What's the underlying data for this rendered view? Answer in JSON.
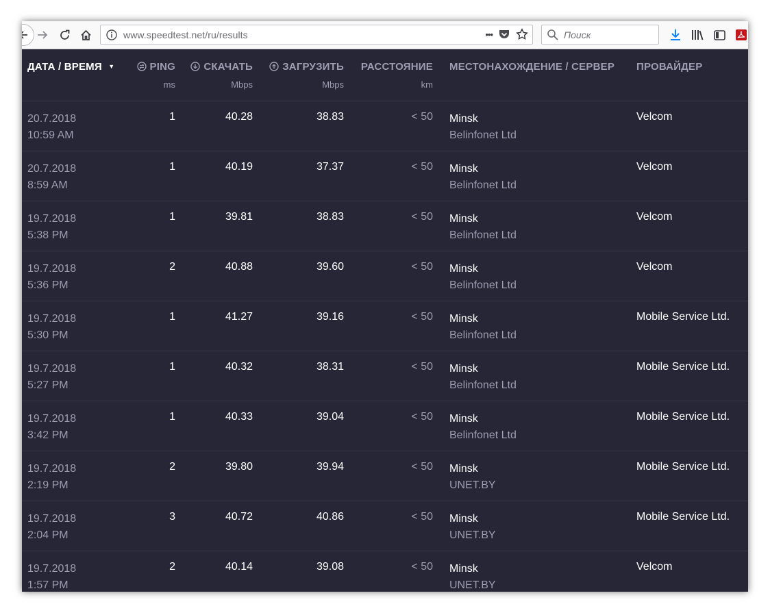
{
  "browser": {
    "url": "www.speedtest.net/ru/results",
    "url_dots": "•••",
    "search_placeholder": "Поиск"
  },
  "table": {
    "headers": {
      "date": "ДАТА / ВРЕМЯ",
      "sort_indicator": "▼",
      "ping": "PING",
      "ping_unit": "ms",
      "download": "СКАЧАТЬ",
      "download_unit": "Mbps",
      "upload": "ЗАГРУЗИТЬ",
      "upload_unit": "Mbps",
      "distance": "РАССТОЯНИЕ",
      "distance_unit": "km",
      "location": "МЕСТОНАХОЖДЕНИЕ / СЕРВЕР",
      "provider": "ПРОВАЙДЕР"
    },
    "rows": [
      {
        "date": "20.7.2018",
        "time": "10:59 AM",
        "ping": "1",
        "download": "40.28",
        "upload": "38.83",
        "distance": "< 50",
        "city": "Minsk",
        "server": "Belinfonet Ltd",
        "provider": "Velcom"
      },
      {
        "date": "20.7.2018",
        "time": "8:59 AM",
        "ping": "1",
        "download": "40.19",
        "upload": "37.37",
        "distance": "< 50",
        "city": "Minsk",
        "server": "Belinfonet Ltd",
        "provider": "Velcom"
      },
      {
        "date": "19.7.2018",
        "time": "5:38 PM",
        "ping": "1",
        "download": "39.81",
        "upload": "38.83",
        "distance": "< 50",
        "city": "Minsk",
        "server": "Belinfonet Ltd",
        "provider": "Velcom"
      },
      {
        "date": "19.7.2018",
        "time": "5:36 PM",
        "ping": "2",
        "download": "40.88",
        "upload": "39.60",
        "distance": "< 50",
        "city": "Minsk",
        "server": "Belinfonet Ltd",
        "provider": "Velcom"
      },
      {
        "date": "19.7.2018",
        "time": "5:30 PM",
        "ping": "1",
        "download": "41.27",
        "upload": "39.16",
        "distance": "< 50",
        "city": "Minsk",
        "server": "Belinfonet Ltd",
        "provider": "Mobile Service Ltd."
      },
      {
        "date": "19.7.2018",
        "time": "5:27 PM",
        "ping": "1",
        "download": "40.32",
        "upload": "38.31",
        "distance": "< 50",
        "city": "Minsk",
        "server": "Belinfonet Ltd",
        "provider": "Mobile Service Ltd."
      },
      {
        "date": "19.7.2018",
        "time": "3:42 PM",
        "ping": "1",
        "download": "40.33",
        "upload": "39.04",
        "distance": "< 50",
        "city": "Minsk",
        "server": "Belinfonet Ltd",
        "provider": "Mobile Service Ltd."
      },
      {
        "date": "19.7.2018",
        "time": "2:19 PM",
        "ping": "2",
        "download": "39.80",
        "upload": "39.94",
        "distance": "< 50",
        "city": "Minsk",
        "server": "UNET.BY",
        "provider": "Mobile Service Ltd."
      },
      {
        "date": "19.7.2018",
        "time": "2:04 PM",
        "ping": "3",
        "download": "40.72",
        "upload": "40.86",
        "distance": "< 50",
        "city": "Minsk",
        "server": "UNET.BY",
        "provider": "Mobile Service Ltd."
      },
      {
        "date": "19.7.2018",
        "time": "1:57 PM",
        "ping": "2",
        "download": "40.14",
        "upload": "39.08",
        "distance": "< 50",
        "city": "Minsk",
        "server": "UNET.BY",
        "provider": "Velcom"
      }
    ]
  }
}
